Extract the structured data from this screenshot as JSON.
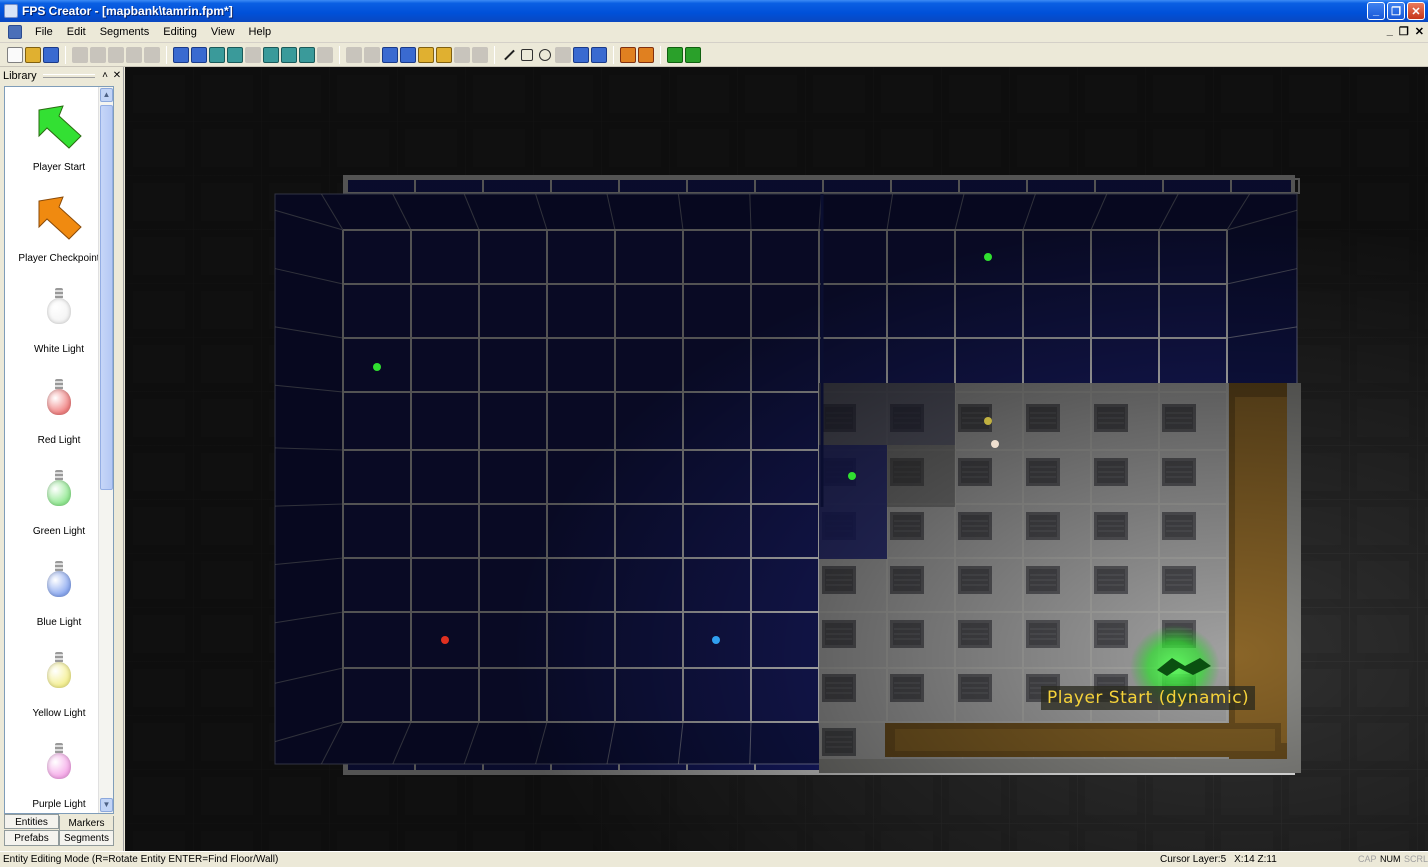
{
  "window": {
    "title": "FPS Creator - [mapbank\\tamrin.fpm*]",
    "minimize": "_",
    "maximize": "❐",
    "close": "✕"
  },
  "menu": {
    "items": [
      "File",
      "Edit",
      "Segments",
      "Editing",
      "View",
      "Help"
    ],
    "mdi_minimize": "_",
    "mdi_restore": "❐",
    "mdi_close": "✕"
  },
  "library": {
    "title": "Library",
    "items": [
      {
        "label": "Player Start",
        "icon": "green-arrow-icon",
        "color": "#33e033"
      },
      {
        "label": "Player Checkpoint",
        "icon": "orange-arrow-icon",
        "color": "#f08a10"
      },
      {
        "label": "White Light",
        "icon": "white-bulb-icon",
        "color": "#f4f4f4"
      },
      {
        "label": "Red Light",
        "icon": "red-bulb-icon",
        "color": "#f08080"
      },
      {
        "label": "Green Light",
        "icon": "green-bulb-icon",
        "color": "#90e890"
      },
      {
        "label": "Blue Light",
        "icon": "blue-bulb-icon",
        "color": "#8aa8f0"
      },
      {
        "label": "Yellow Light",
        "icon": "yellow-bulb-icon",
        "color": "#f4ef90"
      },
      {
        "label": "Purple Light",
        "icon": "purple-bulb-icon",
        "color": "#f5a8e8"
      }
    ],
    "tabs": {
      "entities": "Entities",
      "markers": "Markers",
      "prefabs": "Prefabs",
      "segments": "Segments"
    }
  },
  "viewport": {
    "entity_label": "Player Start (dynamic)",
    "colors": {
      "room_floor": "#1a1f6a",
      "grid_line": "#ffffff",
      "lit_floor": "#9a9a96",
      "accent_label": "#f5d23a"
    }
  },
  "status": {
    "mode": "Entity Editing Mode (R=Rotate Entity  ENTER=Find Floor/Wall)",
    "cursor_layer": "Cursor Layer:5",
    "coords": "X:14  Z:11",
    "cap": "CAP",
    "num": "NUM",
    "scrl": "SCRL"
  }
}
